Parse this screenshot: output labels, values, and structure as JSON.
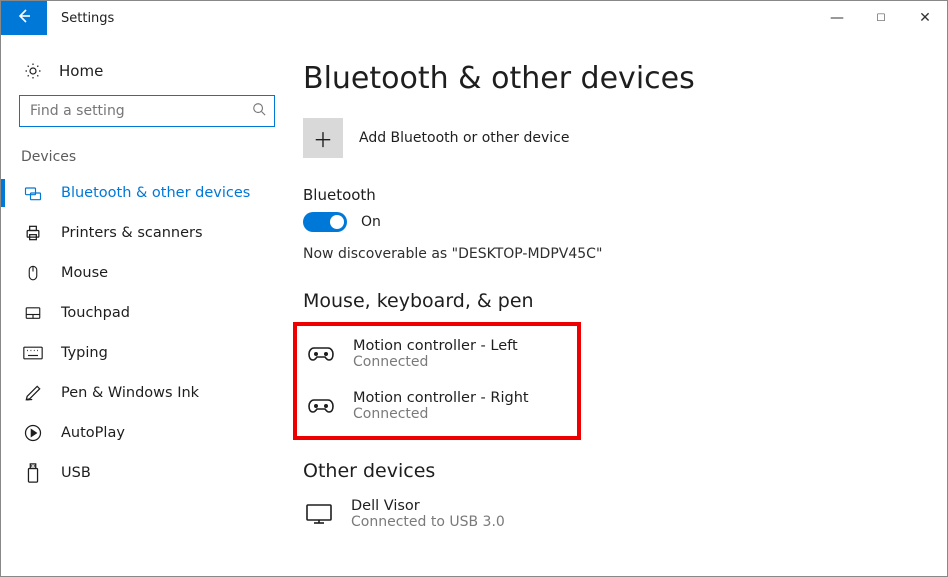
{
  "window": {
    "title": "Settings"
  },
  "sidebar": {
    "home": "Home",
    "search_placeholder": "Find a setting",
    "section": "Devices",
    "items": [
      {
        "label": "Bluetooth & other devices",
        "icon": "bluetooth-devices-icon",
        "selected": true
      },
      {
        "label": "Printers & scanners",
        "icon": "printer-icon",
        "selected": false
      },
      {
        "label": "Mouse",
        "icon": "mouse-icon",
        "selected": false
      },
      {
        "label": "Touchpad",
        "icon": "touchpad-icon",
        "selected": false
      },
      {
        "label": "Typing",
        "icon": "keyboard-icon",
        "selected": false
      },
      {
        "label": "Pen & Windows Ink",
        "icon": "pen-icon",
        "selected": false
      },
      {
        "label": "AutoPlay",
        "icon": "autoplay-icon",
        "selected": false
      },
      {
        "label": "USB",
        "icon": "usb-icon",
        "selected": false
      }
    ]
  },
  "main": {
    "title": "Bluetooth & other devices",
    "add_label": "Add Bluetooth or other device",
    "bluetooth_label": "Bluetooth",
    "toggle_state": "On",
    "discoverable_text": "Now discoverable as \"DESKTOP-MDPV45C\"",
    "groups": [
      {
        "heading": "Mouse, keyboard, & pen",
        "highlight": true,
        "devices": [
          {
            "name": "Motion controller - Left",
            "status": "Connected",
            "icon": "controller-icon"
          },
          {
            "name": "Motion controller - Right",
            "status": "Connected",
            "icon": "controller-icon"
          }
        ]
      },
      {
        "heading": "Other devices",
        "highlight": false,
        "devices": [
          {
            "name": "Dell Visor",
            "status": "Connected to USB 3.0",
            "icon": "monitor-icon"
          }
        ]
      }
    ]
  }
}
